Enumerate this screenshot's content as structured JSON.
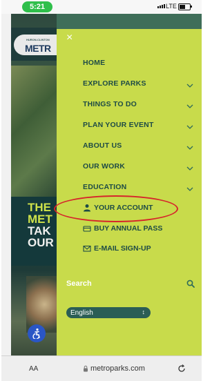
{
  "status_bar": {
    "time": "5:21",
    "network": "LTE"
  },
  "background_page": {
    "logo_small_text": "HURON-CLINTON",
    "logo_text": "METR",
    "headline_lines": [
      "THE",
      "MET",
      "TAK",
      "OUR"
    ]
  },
  "menu": {
    "close_label": "×",
    "items": [
      {
        "label": "HOME",
        "has_submenu": false
      },
      {
        "label": "EXPLORE PARKS",
        "has_submenu": true
      },
      {
        "label": "THINGS TO DO",
        "has_submenu": true
      },
      {
        "label": "PLAN YOUR EVENT",
        "has_submenu": true
      },
      {
        "label": "ABOUT US",
        "has_submenu": true
      },
      {
        "label": "OUR WORK",
        "has_submenu": true
      },
      {
        "label": "EDUCATION",
        "has_submenu": true
      }
    ],
    "account_links": [
      {
        "label": "YOUR ACCOUNT",
        "icon": "user-icon"
      },
      {
        "label": "BUY ANNUAL PASS",
        "icon": "ticket-icon"
      },
      {
        "label": "E-MAIL SIGN-UP",
        "icon": "envelope-icon"
      }
    ],
    "search_label": "Search",
    "language_selected": "English"
  },
  "browser": {
    "text_size_label": "AA",
    "url": "metroparks.com"
  },
  "colors": {
    "menu_bg": "#c8db4b",
    "menu_text": "#1e4b46",
    "highlight_circle": "#d6242b",
    "accent_green": "#2fbf4b"
  }
}
